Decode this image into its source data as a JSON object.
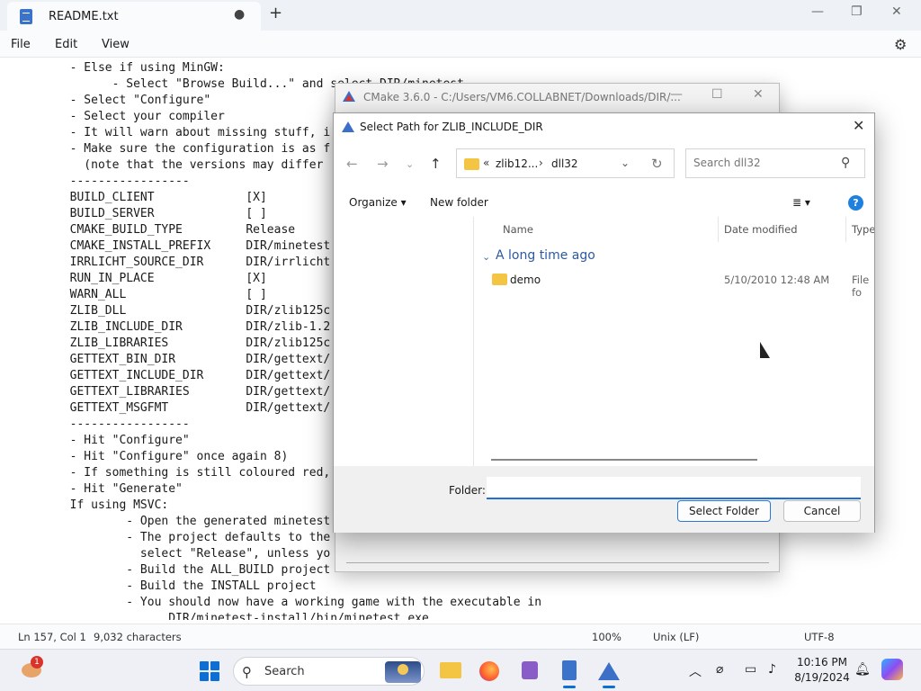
{
  "notepad": {
    "tab_title": "README.txt",
    "modified_dot": "●",
    "new_tab": "+",
    "menu": [
      "File",
      "Edit",
      "View"
    ],
    "lines": [
      "  - Else if using MinGW:",
      "        - Select \"Browse Build...\" and select DIR/minetest",
      "  - Select \"Configure\"",
      "  - Select your compiler",
      "  - It will warn about missing stuff, i",
      "  - Make sure the configuration is as f",
      "    (note that the versions may differ",
      "  -----------------",
      "  BUILD_CLIENT             [X]",
      "  BUILD_SERVER             [ ]",
      "  CMAKE_BUILD_TYPE         Release",
      "  CMAKE_INSTALL_PREFIX     DIR/minetest",
      "  IRRLICHT_SOURCE_DIR      DIR/irrlicht",
      "  RUN_IN_PLACE             [X]",
      "  WARN_ALL                 [ ]",
      "  ZLIB_DLL                 DIR/zlib125c",
      "  ZLIB_INCLUDE_DIR         DIR/zlib-1.2",
      "  ZLIB_LIBRARIES           DIR/zlib125c",
      "  GETTEXT_BIN_DIR          DIR/gettext/",
      "  GETTEXT_INCLUDE_DIR      DIR/gettext/",
      "  GETTEXT_LIBRARIES        DIR/gettext/",
      "  GETTEXT_MSGFMT           DIR/gettext/",
      "  -----------------",
      "  - Hit \"Configure\"",
      "  - Hit \"Configure\" once again 8)",
      "  - If something is still coloured red,",
      "  - Hit \"Generate\"",
      "  If using MSVC:",
      "          - Open the generated minetest",
      "          - The project defaults to the",
      "            select \"Release\", unless yo",
      "          - Build the ALL_BUILD project",
      "          - Build the INSTALL project",
      "          - You should now have a working game with the executable in",
      "                DIR/minetest-install/bin/minetest.exe"
    ],
    "status": {
      "position": "Ln 157, Col 1",
      "chars": "9,032 characters",
      "zoom": "100%",
      "eol": "Unix (LF)",
      "encoding": "UTF-8"
    }
  },
  "cmake": {
    "title": "CMake 3.6.0 - C:/Users/VM6.COLLABNET/Downloads/DIR/..."
  },
  "dialog": {
    "title": "Select Path for ZLIB_INCLUDE_DIR",
    "breadcrumb": {
      "prefix": "«",
      "part1": "zlib12...",
      "sep": "›",
      "part2": "dll32"
    },
    "search_placeholder": "Search dll32",
    "toolbar": {
      "organize": "Organize ▾",
      "new_folder": "New folder",
      "view": "≣ ▾",
      "help": "?"
    },
    "columns": {
      "name": "Name",
      "date": "Date modified",
      "type": "Type"
    },
    "group": "A long time ago",
    "rows": [
      {
        "name": "demo",
        "date": "5/10/2010 12:48 AM",
        "type": "File fo"
      }
    ],
    "folder_label": "Folder:",
    "folder_value": "",
    "select_button": "Select Folder",
    "cancel_button": "Cancel"
  },
  "taskbar": {
    "search_label": "Search",
    "time": "10:16 PM",
    "date": "8/19/2024",
    "badge": "1"
  },
  "colors": {
    "accent": "#1f6fd6",
    "folder": "#f4c542",
    "group_label": "#2c5aa0"
  }
}
